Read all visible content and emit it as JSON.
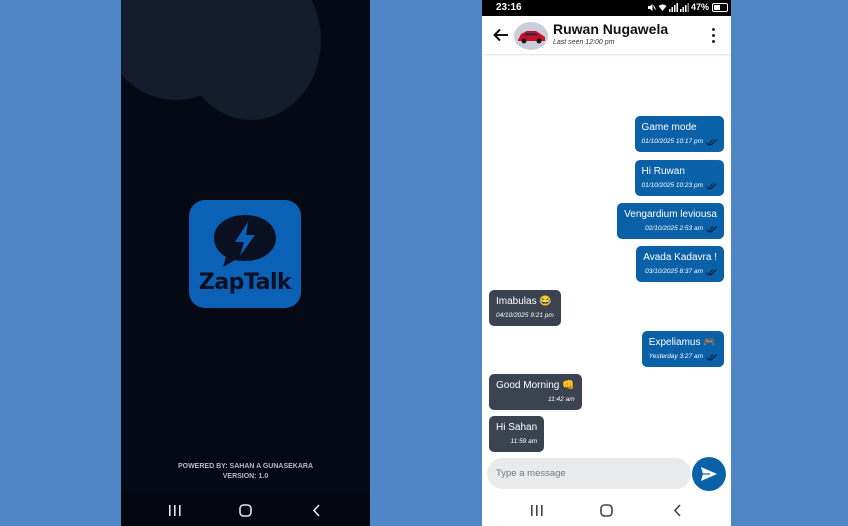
{
  "splash": {
    "brand": "ZapTalk",
    "powered_by": "POWERED BY: SAHAN A GUNASEKARA",
    "version": "VERSION: 1.0",
    "icon": "lightning-chat-bubble-icon"
  },
  "status_bar": {
    "time": "23:16",
    "battery": "47%",
    "icons": [
      "mute-icon",
      "wifi-icon",
      "signal-icon",
      "battery-icon"
    ]
  },
  "chat_header": {
    "contact_name": "Ruwan Nugawela",
    "last_seen": "Last seen 12:00 pm"
  },
  "messages": [
    {
      "direction": "out",
      "text": "Game mode",
      "time": "01/10/2025 10:17 pm",
      "read": true
    },
    {
      "direction": "out",
      "text": "Hi Ruwan",
      "time": "01/10/2025 10:23 pm",
      "read": true
    },
    {
      "direction": "out",
      "text": "Vengardium leviousa",
      "time": "02/10/2025 2:53 am",
      "read": true
    },
    {
      "direction": "out",
      "text": "Avada Kadavra !",
      "time": "03/10/2025 8:37 am",
      "read": true
    },
    {
      "direction": "in",
      "text": "Imabulas 😂",
      "time": "04/10/2025 9:21 pm"
    },
    {
      "direction": "out",
      "text": "Expeliamus 🎮",
      "time": "Yesterday 3:27 am",
      "read": true
    },
    {
      "direction": "in",
      "text": "Good Morning 👊",
      "time": "11:42 am"
    },
    {
      "direction": "in",
      "text": "Hi Sahan",
      "time": "11:59 am"
    }
  ],
  "composer": {
    "placeholder": "Type a message"
  },
  "colors": {
    "background": "#4f86c6",
    "splash_bg": "#050914",
    "brand_blue": "#0b61b5",
    "outgoing_bubble": "#0b61a8",
    "incoming_bubble": "#3b4350"
  }
}
